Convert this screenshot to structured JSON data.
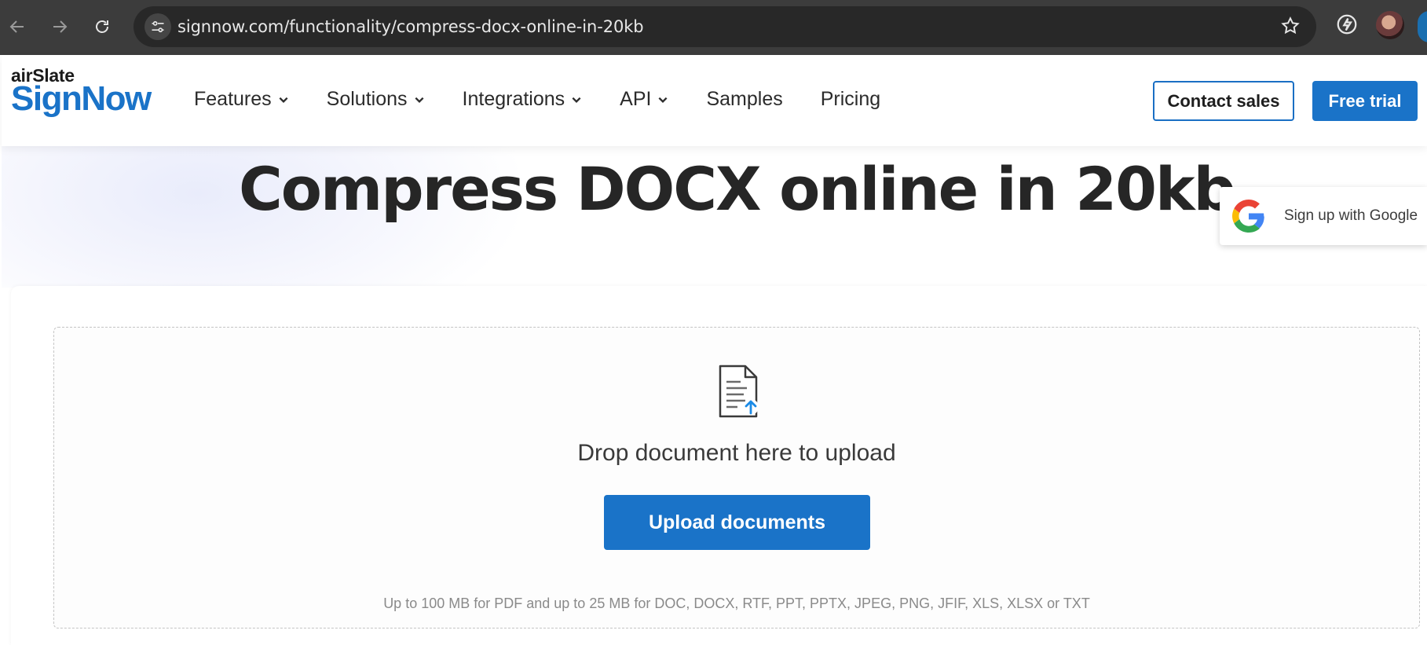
{
  "browser": {
    "url": "signnow.com/functionality/compress-docx-online-in-20kb"
  },
  "header": {
    "logo_top": "airSlate",
    "logo_main": "SignNow",
    "nav": [
      {
        "label": "Features"
      },
      {
        "label": "Solutions"
      },
      {
        "label": "Integrations"
      },
      {
        "label": "API"
      },
      {
        "label": "Samples"
      },
      {
        "label": "Pricing"
      }
    ],
    "contact_label": "Contact sales",
    "trial_label": "Free trial"
  },
  "hero": {
    "title": "Compress DOCX online in 20kb"
  },
  "google_popup": {
    "text": "Sign up with Google"
  },
  "upload": {
    "drop_text": "Drop document here to upload",
    "button_label": "Upload documents",
    "limits": "Up to 100 MB for PDF and up to 25 MB for DOC, DOCX, RTF, PPT, PPTX, JPEG, PNG, JFIF, XLS, XLSX or TXT"
  },
  "colors": {
    "brand_blue": "#1a73c8",
    "upload_arrow": "#1a8ae6"
  }
}
